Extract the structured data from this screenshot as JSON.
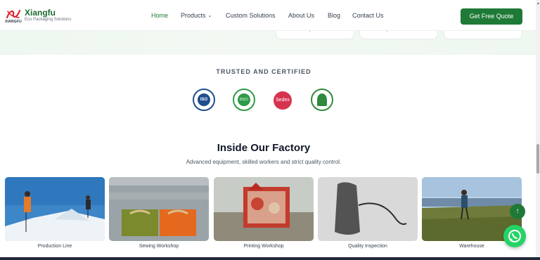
{
  "brand": {
    "name": "Xiangfu",
    "tagline": "Eco Packaging Solutions",
    "logo_text": "XIANGFU",
    "accent": "#1e7a36",
    "logo_color": "#d8262e"
  },
  "nav": {
    "items": [
      "Home",
      "Products",
      "Custom Solutions",
      "About Us",
      "Blog",
      "Contact Us"
    ],
    "active": "Home",
    "products_chevron": "chevron-down-icon",
    "cta": "Get Free Quote"
  },
  "hero_cards": [
    "options.",
    "processes.",
    ""
  ],
  "trusted": {
    "heading": "TRUSTED AND CERTIFIED",
    "badges": [
      {
        "name": "iso-icon",
        "label": "ISO",
        "color": "#1f4e8c"
      },
      {
        "name": "bsci-icon",
        "label": "BSCI",
        "color": "#2e9a47"
      },
      {
        "name": "sedex-icon",
        "label": "Sedex",
        "color": "#d6334f"
      },
      {
        "name": "gots-icon",
        "label": "",
        "color": "#2f8a3e"
      }
    ]
  },
  "factory": {
    "title": "Inside Our Factory",
    "subtitle": "Advanced equipment, skilled workers and strict quality control.",
    "tiles": [
      "Production Line",
      "Sewing Workshop",
      "Printing Workshop",
      "Quality Inspection",
      "Warehouse"
    ]
  },
  "floating": {
    "scroll_top_icon": "arrow-up-icon",
    "chat_icon": "whatsapp-icon",
    "chat_color": "#25d366"
  }
}
